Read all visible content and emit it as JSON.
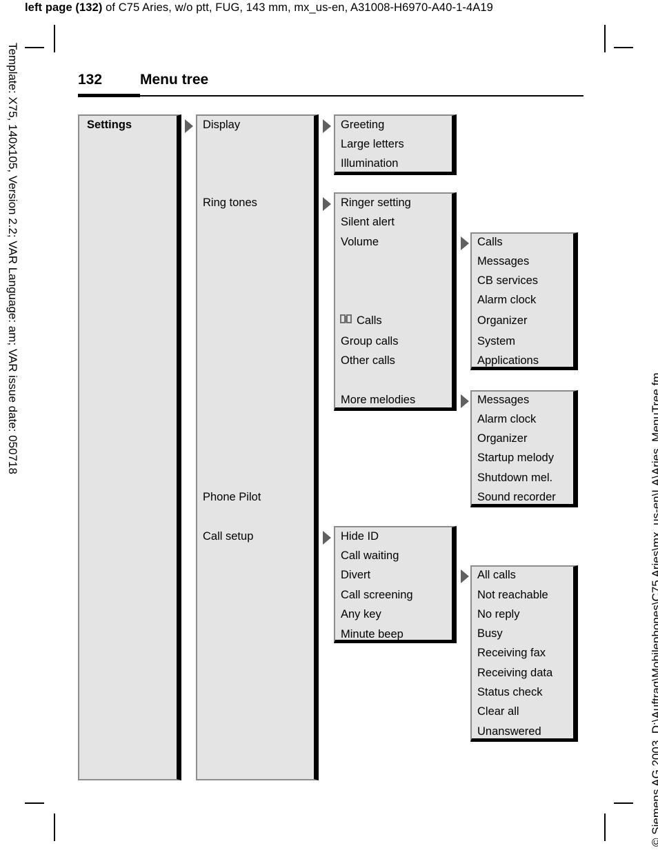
{
  "doc_header": {
    "bold_prefix": "left page (132)",
    "rest": " of C75 Aries, w/o ptt, FUG, 143 mm, mx_us-en, A31008-H6970-A40-1-4A19"
  },
  "side_text": {
    "left": "Template: X75, 140x105, Version 2.2; VAR Language: am; VAR issue date: 050718",
    "right": "© Siemens AG 2003, D:\\Auftrag\\Mobilephones\\C75 Aries\\mx_us-en\\LA\\Aries_MenuTree.fm"
  },
  "page": {
    "number": "132",
    "title": "Menu tree"
  },
  "menu": {
    "root": "Settings",
    "level2": [
      {
        "label": "Display",
        "has_arrow": true
      },
      {
        "label": "Ring tones",
        "has_arrow": true
      },
      {
        "label": "Phone Pilot",
        "has_arrow": false
      },
      {
        "label": "Call setup",
        "has_arrow": true
      }
    ],
    "display_items": [
      "Greeting",
      "Large letters",
      "Illumination"
    ],
    "ringtones_items": [
      {
        "label": "Ringer setting",
        "icon": null,
        "has_arrow": false
      },
      {
        "label": "Silent alert",
        "icon": null,
        "has_arrow": false
      },
      {
        "label": "Volume",
        "icon": null,
        "has_arrow": true
      },
      {
        "label": "Calls",
        "icon": "book-icon",
        "has_arrow": false
      },
      {
        "label": "Group calls",
        "icon": null,
        "has_arrow": false
      },
      {
        "label": "Other calls",
        "icon": null,
        "has_arrow": false
      },
      {
        "label": "More melodies",
        "icon": null,
        "has_arrow": true
      }
    ],
    "volume_items": [
      "Calls",
      "Messages",
      "CB services",
      "Alarm clock",
      "Organizer",
      "System",
      "Applications"
    ],
    "more_melodies_items": [
      "Messages",
      "Alarm clock",
      "Organizer",
      "Startup melody",
      "Shutdown mel.",
      "Sound recorder"
    ],
    "callsetup_items": [
      {
        "label": "Hide ID",
        "has_arrow": false
      },
      {
        "label": "Call waiting",
        "has_arrow": false
      },
      {
        "label": "Divert",
        "has_arrow": true
      },
      {
        "label": "Call screening",
        "has_arrow": false
      },
      {
        "label": "Any key",
        "has_arrow": false
      },
      {
        "label": "Minute beep",
        "has_arrow": false
      }
    ],
    "divert_items": [
      "All calls",
      "Not reachable",
      "No reply",
      "Busy",
      "Receiving fax",
      "Receiving data",
      "Status check",
      "Clear all",
      "Unanswered"
    ]
  },
  "colors": {
    "panel_fill": "#e4e4e4",
    "panel_edge": "#8c8c8c",
    "shadow": "#000000",
    "arrow": "#606060"
  }
}
